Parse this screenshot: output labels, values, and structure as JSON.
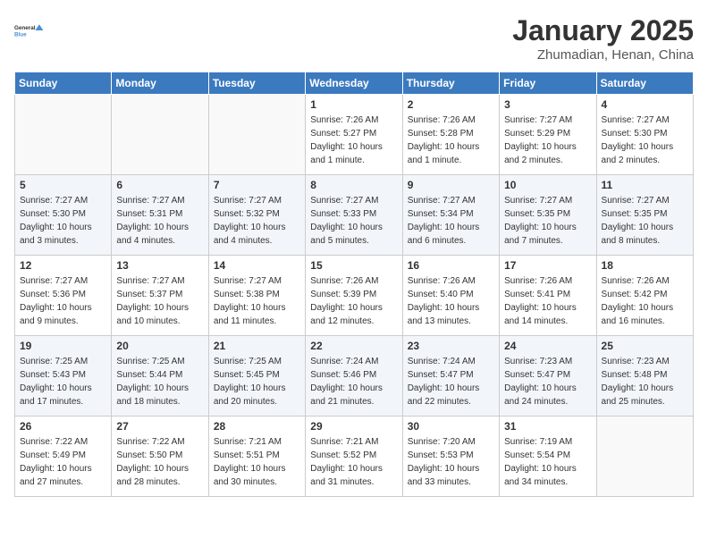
{
  "header": {
    "logo_general": "General",
    "logo_blue": "Blue",
    "title": "January 2025",
    "subtitle": "Zhumadian, Henan, China"
  },
  "weekdays": [
    "Sunday",
    "Monday",
    "Tuesday",
    "Wednesday",
    "Thursday",
    "Friday",
    "Saturday"
  ],
  "weeks": [
    [
      {
        "day": "",
        "sunrise": "",
        "sunset": "",
        "daylight": ""
      },
      {
        "day": "",
        "sunrise": "",
        "sunset": "",
        "daylight": ""
      },
      {
        "day": "",
        "sunrise": "",
        "sunset": "",
        "daylight": ""
      },
      {
        "day": "1",
        "sunrise": "Sunrise: 7:26 AM",
        "sunset": "Sunset: 5:27 PM",
        "daylight": "Daylight: 10 hours and 1 minute."
      },
      {
        "day": "2",
        "sunrise": "Sunrise: 7:26 AM",
        "sunset": "Sunset: 5:28 PM",
        "daylight": "Daylight: 10 hours and 1 minute."
      },
      {
        "day": "3",
        "sunrise": "Sunrise: 7:27 AM",
        "sunset": "Sunset: 5:29 PM",
        "daylight": "Daylight: 10 hours and 2 minutes."
      },
      {
        "day": "4",
        "sunrise": "Sunrise: 7:27 AM",
        "sunset": "Sunset: 5:30 PM",
        "daylight": "Daylight: 10 hours and 2 minutes."
      }
    ],
    [
      {
        "day": "5",
        "sunrise": "Sunrise: 7:27 AM",
        "sunset": "Sunset: 5:30 PM",
        "daylight": "Daylight: 10 hours and 3 minutes."
      },
      {
        "day": "6",
        "sunrise": "Sunrise: 7:27 AM",
        "sunset": "Sunset: 5:31 PM",
        "daylight": "Daylight: 10 hours and 4 minutes."
      },
      {
        "day": "7",
        "sunrise": "Sunrise: 7:27 AM",
        "sunset": "Sunset: 5:32 PM",
        "daylight": "Daylight: 10 hours and 4 minutes."
      },
      {
        "day": "8",
        "sunrise": "Sunrise: 7:27 AM",
        "sunset": "Sunset: 5:33 PM",
        "daylight": "Daylight: 10 hours and 5 minutes."
      },
      {
        "day": "9",
        "sunrise": "Sunrise: 7:27 AM",
        "sunset": "Sunset: 5:34 PM",
        "daylight": "Daylight: 10 hours and 6 minutes."
      },
      {
        "day": "10",
        "sunrise": "Sunrise: 7:27 AM",
        "sunset": "Sunset: 5:35 PM",
        "daylight": "Daylight: 10 hours and 7 minutes."
      },
      {
        "day": "11",
        "sunrise": "Sunrise: 7:27 AM",
        "sunset": "Sunset: 5:35 PM",
        "daylight": "Daylight: 10 hours and 8 minutes."
      }
    ],
    [
      {
        "day": "12",
        "sunrise": "Sunrise: 7:27 AM",
        "sunset": "Sunset: 5:36 PM",
        "daylight": "Daylight: 10 hours and 9 minutes."
      },
      {
        "day": "13",
        "sunrise": "Sunrise: 7:27 AM",
        "sunset": "Sunset: 5:37 PM",
        "daylight": "Daylight: 10 hours and 10 minutes."
      },
      {
        "day": "14",
        "sunrise": "Sunrise: 7:27 AM",
        "sunset": "Sunset: 5:38 PM",
        "daylight": "Daylight: 10 hours and 11 minutes."
      },
      {
        "day": "15",
        "sunrise": "Sunrise: 7:26 AM",
        "sunset": "Sunset: 5:39 PM",
        "daylight": "Daylight: 10 hours and 12 minutes."
      },
      {
        "day": "16",
        "sunrise": "Sunrise: 7:26 AM",
        "sunset": "Sunset: 5:40 PM",
        "daylight": "Daylight: 10 hours and 13 minutes."
      },
      {
        "day": "17",
        "sunrise": "Sunrise: 7:26 AM",
        "sunset": "Sunset: 5:41 PM",
        "daylight": "Daylight: 10 hours and 14 minutes."
      },
      {
        "day": "18",
        "sunrise": "Sunrise: 7:26 AM",
        "sunset": "Sunset: 5:42 PM",
        "daylight": "Daylight: 10 hours and 16 minutes."
      }
    ],
    [
      {
        "day": "19",
        "sunrise": "Sunrise: 7:25 AM",
        "sunset": "Sunset: 5:43 PM",
        "daylight": "Daylight: 10 hours and 17 minutes."
      },
      {
        "day": "20",
        "sunrise": "Sunrise: 7:25 AM",
        "sunset": "Sunset: 5:44 PM",
        "daylight": "Daylight: 10 hours and 18 minutes."
      },
      {
        "day": "21",
        "sunrise": "Sunrise: 7:25 AM",
        "sunset": "Sunset: 5:45 PM",
        "daylight": "Daylight: 10 hours and 20 minutes."
      },
      {
        "day": "22",
        "sunrise": "Sunrise: 7:24 AM",
        "sunset": "Sunset: 5:46 PM",
        "daylight": "Daylight: 10 hours and 21 minutes."
      },
      {
        "day": "23",
        "sunrise": "Sunrise: 7:24 AM",
        "sunset": "Sunset: 5:47 PM",
        "daylight": "Daylight: 10 hours and 22 minutes."
      },
      {
        "day": "24",
        "sunrise": "Sunrise: 7:23 AM",
        "sunset": "Sunset: 5:47 PM",
        "daylight": "Daylight: 10 hours and 24 minutes."
      },
      {
        "day": "25",
        "sunrise": "Sunrise: 7:23 AM",
        "sunset": "Sunset: 5:48 PM",
        "daylight": "Daylight: 10 hours and 25 minutes."
      }
    ],
    [
      {
        "day": "26",
        "sunrise": "Sunrise: 7:22 AM",
        "sunset": "Sunset: 5:49 PM",
        "daylight": "Daylight: 10 hours and 27 minutes."
      },
      {
        "day": "27",
        "sunrise": "Sunrise: 7:22 AM",
        "sunset": "Sunset: 5:50 PM",
        "daylight": "Daylight: 10 hours and 28 minutes."
      },
      {
        "day": "28",
        "sunrise": "Sunrise: 7:21 AM",
        "sunset": "Sunset: 5:51 PM",
        "daylight": "Daylight: 10 hours and 30 minutes."
      },
      {
        "day": "29",
        "sunrise": "Sunrise: 7:21 AM",
        "sunset": "Sunset: 5:52 PM",
        "daylight": "Daylight: 10 hours and 31 minutes."
      },
      {
        "day": "30",
        "sunrise": "Sunrise: 7:20 AM",
        "sunset": "Sunset: 5:53 PM",
        "daylight": "Daylight: 10 hours and 33 minutes."
      },
      {
        "day": "31",
        "sunrise": "Sunrise: 7:19 AM",
        "sunset": "Sunset: 5:54 PM",
        "daylight": "Daylight: 10 hours and 34 minutes."
      },
      {
        "day": "",
        "sunrise": "",
        "sunset": "",
        "daylight": ""
      }
    ]
  ]
}
